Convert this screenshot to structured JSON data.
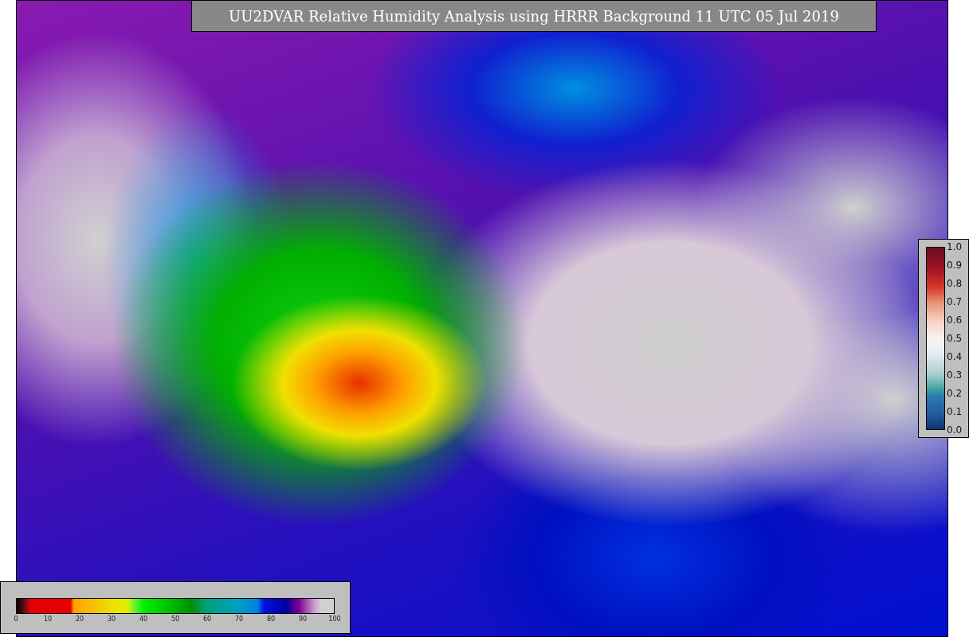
{
  "title": "UU2DVAR Relative Humidity Analysis using HRRR Background 11 UTC 05 Jul 2019",
  "humidity_colorbar": {
    "ticks": [
      "0",
      "10",
      "20",
      "30",
      "40",
      "50",
      "60",
      "70",
      "80",
      "90",
      "100"
    ]
  },
  "observation_colorbar": {
    "ticks": [
      "1.0",
      "0.9",
      "0.8",
      "0.7",
      "0.6",
      "0.5",
      "0.4",
      "0.3",
      "0.2",
      "0.1",
      "0.0"
    ]
  }
}
